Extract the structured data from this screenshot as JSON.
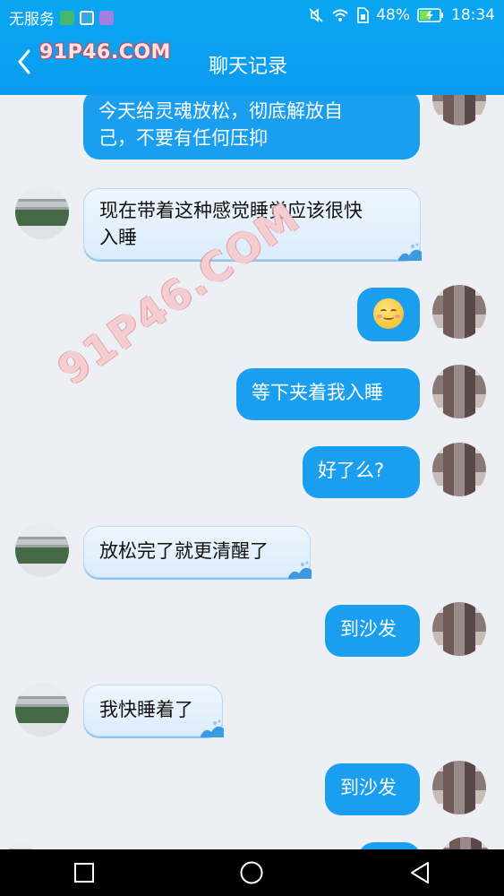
{
  "status_bar": {
    "carrier": "无服务",
    "battery": "48%",
    "time": "18:34"
  },
  "header": {
    "watermark": "91P46.COM",
    "title": "聊天记录"
  },
  "watermark_diagonal": "91P46.COM",
  "messages": [
    {
      "sender": "self",
      "text_line1": "今天给灵魂放松，彻底解放自",
      "text_line2": "己，不要有任何压抑"
    },
    {
      "sender": "friend",
      "text_line1": "现在带着这种感觉睡觉应该很快",
      "text_line2": "入睡"
    },
    {
      "sender": "self",
      "emoji": "smiling-blush-emoji"
    },
    {
      "sender": "self",
      "text": "等下夹着我入睡"
    },
    {
      "sender": "self",
      "text": "好了么?"
    },
    {
      "sender": "friend",
      "text": "放松完了就更清醒了"
    },
    {
      "sender": "self",
      "text": "到沙发"
    },
    {
      "sender": "friend",
      "text": "我快睡着了"
    },
    {
      "sender": "self",
      "text": "到沙发"
    }
  ],
  "colors": {
    "header_blue": "#0aa6f2",
    "self_bubble": "#1a9ff0",
    "friend_bubble": "#eef6fd",
    "background": "#eceff4"
  }
}
